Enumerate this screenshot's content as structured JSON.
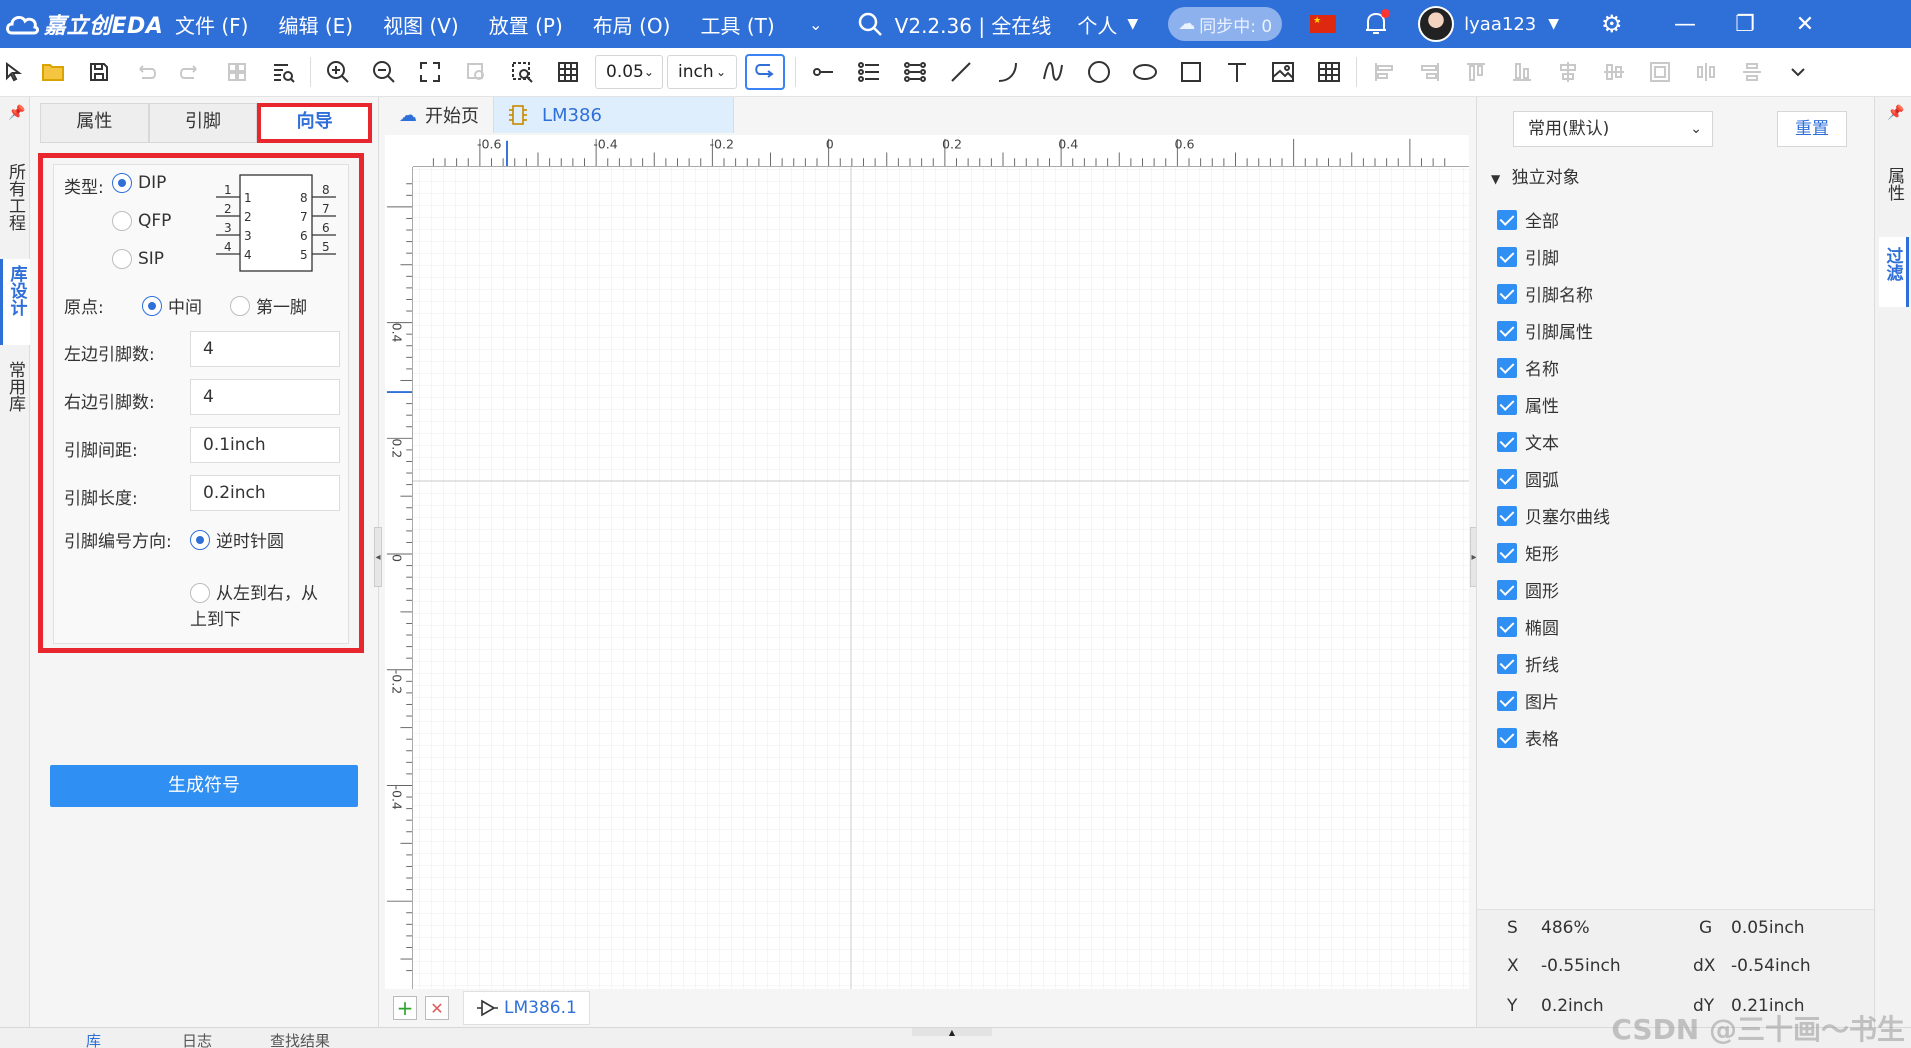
{
  "app": {
    "logo_text": "嘉立创EDA",
    "menus": [
      "文件 (F)",
      "编辑 (E)",
      "视图 (V)",
      "放置 (P)",
      "布局 (O)",
      "工具 (T)"
    ],
    "version": "V2.2.36 | 全在线",
    "account_mode": "个人",
    "sync_status": "同步中: 0",
    "username": "lyaa123"
  },
  "toolbar": {
    "grid_size": "0.05",
    "unit": "inch"
  },
  "left_strip": {
    "tabs": [
      "所有工程",
      "库设计",
      "常用库"
    ]
  },
  "left_panel": {
    "tabs": [
      "属性",
      "引脚",
      "向导"
    ],
    "active_tab": "向导",
    "wizard": {
      "type_label": "类型:",
      "type_options": [
        "DIP",
        "QFP",
        "SIP"
      ],
      "type_selected": "DIP",
      "origin_label": "原点:",
      "origin_options": [
        "中间",
        "第一脚"
      ],
      "origin_selected": "中间",
      "left_pins_label": "左边引脚数:",
      "left_pins_value": "4",
      "right_pins_label": "右边引脚数:",
      "right_pins_value": "4",
      "pin_spacing_label": "引脚间距:",
      "pin_spacing_value": "0.1inch",
      "pin_length_label": "引脚长度:",
      "pin_length_value": "0.2inch",
      "numbering_label": "引脚编号方向:",
      "numbering_options": [
        "逆时针圆",
        "从左到右，从上到下"
      ],
      "numbering_selected": "逆时针圆",
      "diagram": {
        "left_pins": [
          "1",
          "2",
          "3",
          "4"
        ],
        "right_pins": [
          "8",
          "7",
          "6",
          "5"
        ],
        "inner_left": [
          "1",
          "2",
          "3",
          "4"
        ],
        "inner_right": [
          "8",
          "7",
          "6",
          "5"
        ]
      }
    },
    "generate_button": "生成符号"
  },
  "canvas": {
    "tabs": [
      "开始页",
      "LM386"
    ],
    "active_tab": "LM386",
    "ruler_top_labels": [
      "-0.6",
      "-0.4",
      "-0.2",
      "0",
      "0.2",
      "0.4",
      "0.6"
    ],
    "ruler_left_labels": [
      "0.4",
      "0.2",
      "0",
      "-0.2",
      "-0.4"
    ],
    "sheet_tab": "LM386.1"
  },
  "right_panel": {
    "preset": "常用(默认)",
    "reset_button": "重置",
    "group_title": "独立对象",
    "filters": [
      "全部",
      "引脚",
      "引脚名称",
      "引脚属性",
      "名称",
      "属性",
      "文本",
      "圆弧",
      "贝塞尔曲线",
      "矩形",
      "圆形",
      "椭圆",
      "折线",
      "图片",
      "表格"
    ],
    "status": {
      "s_label": "S",
      "s_value": "486%",
      "g_label": "G",
      "g_value": "0.05inch",
      "x_label": "X",
      "x_value": "-0.55inch",
      "dx_label": "dX",
      "dx_value": "-0.54inch",
      "y_label": "Y",
      "y_value": "0.2inch",
      "dy_label": "dY",
      "dy_value": "0.21inch"
    }
  },
  "right_strip": {
    "tabs": [
      "属性",
      "过滤"
    ]
  },
  "bottom_bar": {
    "tabs": [
      "库",
      "日志",
      "查找结果"
    ]
  },
  "watermark": "CSDN @三十画～书生",
  "colors": {
    "titlebar": "#2f6fd8",
    "accent": "#2f8ff2",
    "highlight_frame": "#e8262d"
  }
}
